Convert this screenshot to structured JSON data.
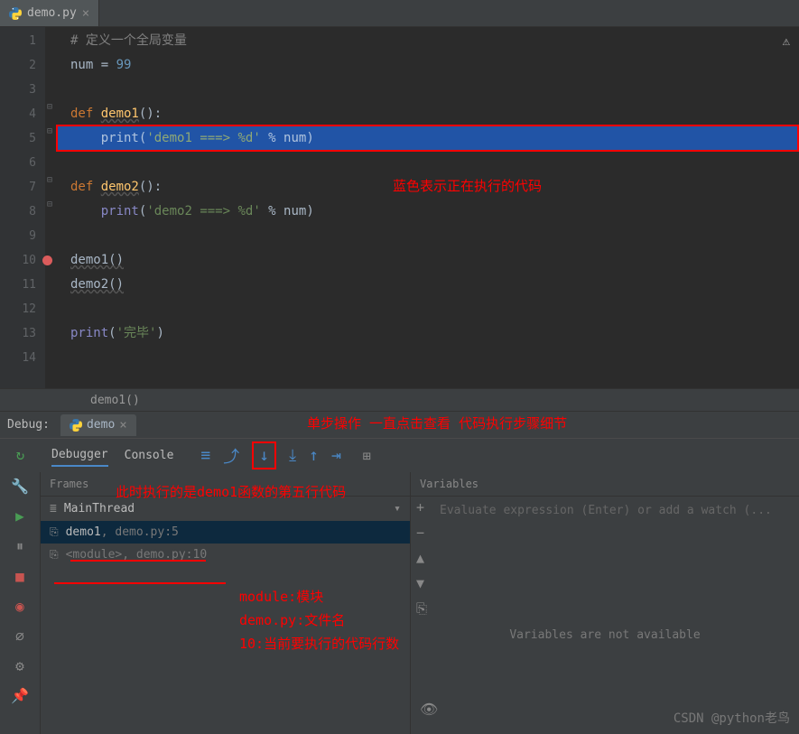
{
  "tab": {
    "filename": "demo.py"
  },
  "code": {
    "l1_comment": "# 定义一个全局变量",
    "l2_a": "num ",
    "l2_b": "= ",
    "l2_c": "99",
    "l4_a": "def ",
    "l4_b": "demo1",
    "l4_c": "():",
    "l5_a": "    ",
    "l5_b": "print",
    "l5_c": "(",
    "l5_d": "'demo1 ===> %d'",
    "l5_e": " % num)",
    "l7_a": "def ",
    "l7_b": "demo2",
    "l7_c": "():",
    "l8_a": "    ",
    "l8_b": "print",
    "l8_c": "(",
    "l8_d": "'demo2 ===> %d'",
    "l8_e": " % num)",
    "l10": "demo1()",
    "l11": "demo2()",
    "l13_a": "print",
    "l13_b": "(",
    "l13_c": "'完毕'",
    "l13_d": ")"
  },
  "lines": [
    "1",
    "2",
    "3",
    "4",
    "5",
    "6",
    "7",
    "8",
    "9",
    "10",
    "11",
    "12",
    "13",
    "14"
  ],
  "breadcrumb": "demo1()",
  "debug": {
    "label": "Debug:",
    "tab_name": "demo",
    "debugger": "Debugger",
    "console": "Console"
  },
  "frames": {
    "title": "Frames",
    "thread": "MainThread",
    "f1_name": "demo1",
    "f1_loc": ", demo.py:5",
    "f2_name": "<module>",
    "f2_loc": ", demo.py:10"
  },
  "variables": {
    "title": "Variables",
    "eval_hint": "Evaluate expression (Enter) or add a watch (...",
    "empty": "Variables are not available"
  },
  "annotations": {
    "a1": "蓝色表示正在执行的代码",
    "a2": "单步操作  一直点击查看  代码执行步骤细节",
    "a3": "此时执行的是demo1函数的第五行代码",
    "a4_l1": "module:模块",
    "a4_l2": "demo.py:文件名",
    "a4_l3": "10:当前要执行的代码行数"
  },
  "watermark": "CSDN @python老鸟"
}
